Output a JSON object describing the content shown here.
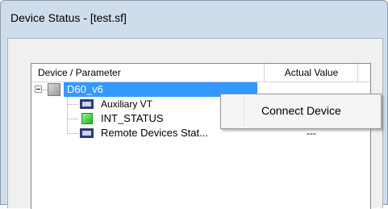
{
  "window": {
    "title": "Device Status - [test.sf]"
  },
  "table": {
    "columns": [
      "Device / Parameter",
      "Actual Value"
    ],
    "rows": [
      {
        "label": "D60_v6",
        "value": "",
        "icon": "device-gray-icon",
        "selected": true
      },
      {
        "label": "Auxiliary VT",
        "value": "",
        "icon": "parameter-icon"
      },
      {
        "label": "INT_STATUS",
        "value": "---",
        "icon": "status-green-icon"
      },
      {
        "label": "Remote Devices Stat...",
        "value": "---",
        "icon": "parameter-icon"
      }
    ]
  },
  "context_menu": {
    "items": [
      "Connect Device"
    ]
  },
  "colors": {
    "selection": "#3399ff",
    "status_ok": "#22b022"
  }
}
